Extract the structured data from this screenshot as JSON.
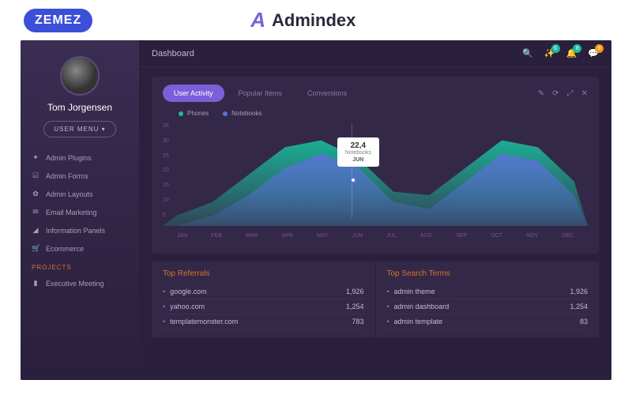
{
  "logos": {
    "zemez": "ZEMEZ",
    "admindex": "Admindex"
  },
  "sidebar": {
    "username": "Tom Jorgensen",
    "usermenu": "USER MENU ▾",
    "items": [
      {
        "icon": "✦",
        "label": "Admin Plugins"
      },
      {
        "icon": "☑",
        "label": "Admin Forms"
      },
      {
        "icon": "✿",
        "label": "Admin Layouts"
      },
      {
        "icon": "✉",
        "label": "Email Marketing"
      },
      {
        "icon": "◢",
        "label": "Information Panels"
      },
      {
        "icon": "🛒",
        "label": "Ecommerce"
      }
    ],
    "section": "PROJECTS",
    "projects": [
      {
        "icon": "▮",
        "label": "Executive Meeting"
      }
    ]
  },
  "topbar": {
    "title": "Dashboard",
    "badges": {
      "wand": "6",
      "bell": "8",
      "chat": "9"
    }
  },
  "chart": {
    "tabs": [
      {
        "label": "User Activity",
        "active": true
      },
      {
        "label": "Popular Items",
        "active": false
      },
      {
        "label": "Conversions",
        "active": false
      }
    ],
    "legend": [
      {
        "color": "teal",
        "label": "Phones"
      },
      {
        "color": "blue",
        "label": "Notebooks"
      }
    ],
    "tooltip": {
      "value": "22,4",
      "series": "Notebooks",
      "month": "JUN"
    }
  },
  "chart_data": {
    "type": "area",
    "categories": [
      "JAN",
      "FEB",
      "MAR",
      "APR",
      "MAY",
      "JUN",
      "JUL",
      "AUG",
      "SEP",
      "OCT",
      "NOV",
      "DEC"
    ],
    "series": [
      {
        "name": "Phones",
        "values": [
          8,
          12,
          20,
          28,
          30,
          25,
          15,
          14,
          22,
          30,
          28,
          18
        ]
      },
      {
        "name": "Notebooks",
        "values": [
          5,
          8,
          14,
          22,
          26,
          22.4,
          12,
          10,
          18,
          26,
          24,
          14
        ]
      }
    ],
    "ylabel": "",
    "xlabel": "",
    "ylim": [
      5,
      35
    ],
    "yticks": [
      35,
      30,
      25,
      20,
      15,
      10,
      5
    ]
  },
  "tables": {
    "referrals": {
      "title": "Top Referrals",
      "rows": [
        {
          "name": "google.com",
          "value": "1,926"
        },
        {
          "name": "yahoo.com",
          "value": "1,254"
        },
        {
          "name": "templatemonster.com",
          "value": "783"
        }
      ]
    },
    "search": {
      "title": "Top Search Terms",
      "rows": [
        {
          "name": "admin theme",
          "value": "1,926"
        },
        {
          "name": "admin dashboard",
          "value": "1,254"
        },
        {
          "name": "admin template",
          "value": "83"
        }
      ]
    }
  }
}
